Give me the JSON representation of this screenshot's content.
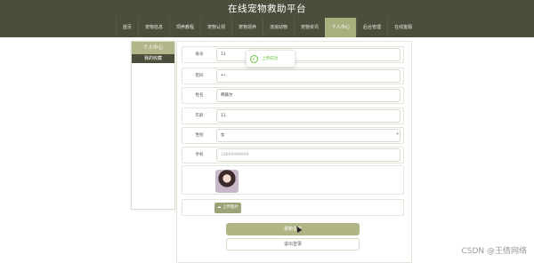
{
  "app": {
    "title": "在线宠物救助平台"
  },
  "nav": {
    "items": [
      "首页",
      "宠物信息",
      "饲养教程",
      "宠物认领",
      "宠物领养",
      "流浪动物",
      "宠物资讯",
      "个人中心",
      "后台管理",
      "在线客服"
    ],
    "active_index": 7
  },
  "sidebar": {
    "header": "个人中心",
    "items": [
      "我的收藏"
    ]
  },
  "toast": {
    "text": "上传成功"
  },
  "form": {
    "fields": [
      {
        "label": "账号",
        "value": "11"
      },
      {
        "label": "密码",
        "value": "••"
      },
      {
        "label": "姓名",
        "value": "韩嘉尔"
      },
      {
        "label": "年龄",
        "value": "11"
      },
      {
        "label": "性别",
        "value": "女"
      },
      {
        "label": "手机",
        "value": "",
        "placeholder": "18899999999"
      }
    ],
    "upload_label": "上传图片",
    "submit_label": "更新信息",
    "logout_label": "退出登录"
  },
  "watermark": "CSDN @王倩网络",
  "colors": {
    "header_bg": "#4b4e3a",
    "accent": "#a9b080",
    "button_bg": "#b1b586",
    "success": "#67c23a"
  }
}
